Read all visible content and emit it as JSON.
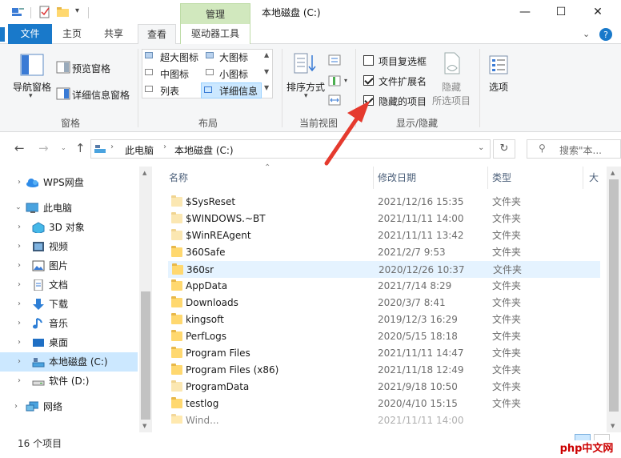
{
  "window": {
    "title": "本地磁盘 (C:)",
    "context_tab": "管理",
    "controls": {
      "minimize": "—",
      "maximize": "☐",
      "close": "✕"
    }
  },
  "ribbon_tabs": [
    {
      "label": "文件",
      "active": false
    },
    {
      "label": "主页",
      "active": false
    },
    {
      "label": "共享",
      "active": false
    },
    {
      "label": "查看",
      "active": true
    },
    {
      "label": "驱动器工具",
      "active": false
    }
  ],
  "ribbon": {
    "panes": {
      "navigation_pane": "导航窗格",
      "preview_pane": "预览窗格",
      "details_pane": "详细信息窗格",
      "group_label": "窗格"
    },
    "layout": {
      "extra_large": "超大图标",
      "large": "大图标",
      "medium": "中图标",
      "small": "小图标",
      "list": "列表",
      "details": "详细信息",
      "group_label": "布局"
    },
    "current_view": {
      "sort_by": "排序方式",
      "group_label": "当前视图"
    },
    "show_hide": {
      "item_checkboxes": {
        "label": "项目复选框",
        "checked": false
      },
      "file_extensions": {
        "label": "文件扩展名",
        "checked": true
      },
      "hidden_items": {
        "label": "隐藏的项目",
        "checked": true
      },
      "hide_selected_1": "隐藏",
      "hide_selected_2": "所选项目",
      "group_label": "显示/隐藏"
    },
    "options": "选项"
  },
  "address": {
    "segments": [
      "此电脑",
      "本地磁盘 (C:)"
    ],
    "search_placeholder": "搜索\"本..."
  },
  "nav_pane": [
    {
      "label": "WPS网盘",
      "icon": "cloud-icon"
    },
    {
      "label": "此电脑",
      "icon": "computer-icon"
    },
    {
      "label": "3D 对象",
      "icon": "3d-objects-icon"
    },
    {
      "label": "视频",
      "icon": "video-icon"
    },
    {
      "label": "图片",
      "icon": "pictures-icon"
    },
    {
      "label": "文档",
      "icon": "documents-icon"
    },
    {
      "label": "下载",
      "icon": "download-icon"
    },
    {
      "label": "音乐",
      "icon": "music-icon"
    },
    {
      "label": "桌面",
      "icon": "desktop-icon"
    },
    {
      "label": "本地磁盘 (C:)",
      "icon": "drive-icon",
      "selected": true
    },
    {
      "label": "软件 (D:)",
      "icon": "drive-icon"
    },
    {
      "label": "网络",
      "icon": "network-icon"
    }
  ],
  "columns": {
    "name": "名称",
    "date": "修改日期",
    "type": "类型",
    "size": "大"
  },
  "files": [
    {
      "name": "$SysReset",
      "date": "2021/12/16 15:35",
      "type": "文件夹",
      "hidden": true
    },
    {
      "name": "$WINDOWS.~BT",
      "date": "2021/11/11 14:00",
      "type": "文件夹",
      "hidden": true
    },
    {
      "name": "$WinREAgent",
      "date": "2021/11/11 13:42",
      "type": "文件夹",
      "hidden": true
    },
    {
      "name": "360Safe",
      "date": "2021/2/7 9:53",
      "type": "文件夹",
      "hidden": false
    },
    {
      "name": "360sr",
      "date": "2020/12/26 10:37",
      "type": "文件夹",
      "hidden": false,
      "hover": true
    },
    {
      "name": "AppData",
      "date": "2021/7/14 8:29",
      "type": "文件夹",
      "hidden": false
    },
    {
      "name": "Downloads",
      "date": "2020/3/7 8:41",
      "type": "文件夹",
      "hidden": false
    },
    {
      "name": "kingsoft",
      "date": "2019/12/3 16:29",
      "type": "文件夹",
      "hidden": false
    },
    {
      "name": "PerfLogs",
      "date": "2020/5/15 18:18",
      "type": "文件夹",
      "hidden": false
    },
    {
      "name": "Program Files",
      "date": "2021/11/11 14:47",
      "type": "文件夹",
      "hidden": false
    },
    {
      "name": "Program Files (x86)",
      "date": "2021/11/18 12:49",
      "type": "文件夹",
      "hidden": false
    },
    {
      "name": "ProgramData",
      "date": "2021/9/18 10:50",
      "type": "文件夹",
      "hidden": true
    },
    {
      "name": "testlog",
      "date": "2020/4/10 15:15",
      "type": "文件夹",
      "hidden": false
    },
    {
      "name": "Wind...",
      "date": "2021/11/11 14:00",
      "type": "",
      "hidden": false
    }
  ],
  "status": {
    "count": "16 个项目"
  },
  "watermark": {
    "text": "php中文网"
  },
  "colors": {
    "accent": "#1979ca",
    "selection": "#cce8ff",
    "annotation": "#e53a2e"
  }
}
